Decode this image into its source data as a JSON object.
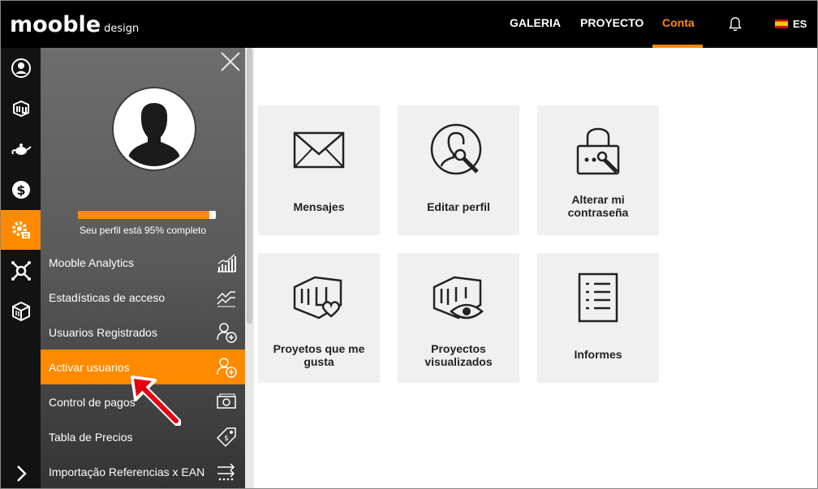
{
  "header": {
    "logo_main": "mooble",
    "logo_sub": "design",
    "nav": [
      {
        "label": "GALERIA"
      },
      {
        "label": "PROYECTO"
      },
      {
        "label": "Conta"
      }
    ],
    "language": "ES",
    "accent_color": "#ff8a00"
  },
  "rail": {
    "icons": [
      "user-icon",
      "mooble-3d-icon",
      "teapot-icon",
      "dollar-icon",
      "settings-icon",
      "network-icon",
      "cube-icon",
      "chevron-right-icon"
    ],
    "active": "settings-icon"
  },
  "panel": {
    "profile_progress": 0.95,
    "progress_text": "Seu perfil está 95% completo",
    "menu": [
      {
        "label": "Mooble Analytics",
        "icon": "analytics-chart-icon"
      },
      {
        "label": "Estadísticas de acceso",
        "icon": "line-trend-icon"
      },
      {
        "label": "Usuarios Registrados",
        "icon": "add-user-icon"
      },
      {
        "label": "Activar usuarios",
        "icon": "add-user-icon"
      },
      {
        "label": "Control de pagos",
        "icon": "money-icon"
      },
      {
        "label": "Tabla de Precios",
        "icon": "price-tag-icon"
      },
      {
        "label": "Importação Referencias x EAN",
        "icon": "import-arrows-icon"
      }
    ],
    "active_item": "Activar usuarios"
  },
  "tiles": [
    {
      "label": "Mensajes",
      "icon": "envelope-icon"
    },
    {
      "label": "Editar perfil",
      "icon": "edit-profile-icon"
    },
    {
      "label": "Alterar mi contraseña",
      "icon": "lock-icon"
    },
    {
      "label": "Proyetos que me gusta",
      "icon": "liked-projects-icon"
    },
    {
      "label": "Proyectos visualizados",
      "icon": "viewed-projects-icon"
    },
    {
      "label": "Informes",
      "icon": "report-icon"
    }
  ]
}
